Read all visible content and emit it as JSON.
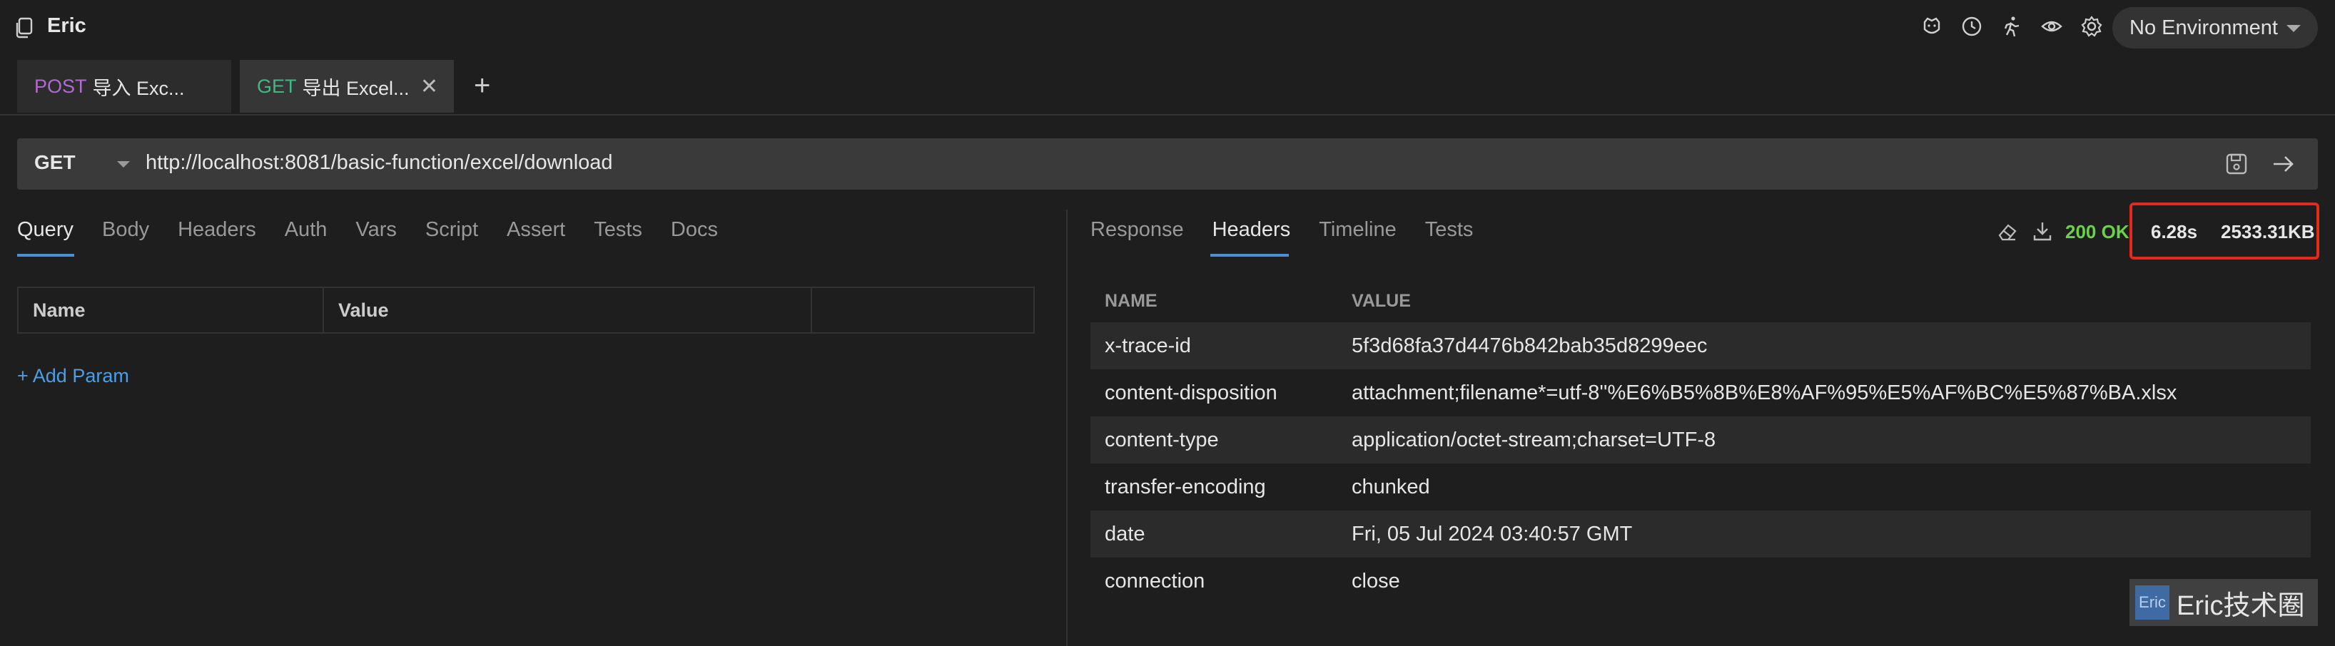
{
  "collection": {
    "name": "Eric"
  },
  "top_icons": [
    "bruno-icon",
    "history-icon",
    "runner-icon",
    "eye-icon",
    "gear-icon"
  ],
  "environment": {
    "selected": "No Environment"
  },
  "tabs": [
    {
      "method": "POST",
      "name": "导入 Exc..."
    },
    {
      "method": "GET",
      "name": "导出 Excel..."
    }
  ],
  "request": {
    "method": "GET",
    "url": "http://localhost:8081/basic-function/excel/download"
  },
  "left_tabs": [
    "Query",
    "Body",
    "Headers",
    "Auth",
    "Vars",
    "Script",
    "Assert",
    "Tests",
    "Docs"
  ],
  "params_table": {
    "columns": [
      "Name",
      "Value"
    ]
  },
  "add_param_label": "+ Add Param",
  "right_tabs": [
    "Response",
    "Headers",
    "Timeline",
    "Tests"
  ],
  "response": {
    "status": "200 OK",
    "duration": "6.28s",
    "size": "2533.31KB",
    "header_columns": [
      "NAME",
      "VALUE"
    ],
    "headers": [
      {
        "name": "x-trace-id",
        "value": "5f3d68fa37d4476b842bab35d8299eec"
      },
      {
        "name": "content-disposition",
        "value": "attachment;filename*=utf-8''%E6%B5%8B%E8%AF%95%E5%AF%BC%E5%87%BA.xlsx"
      },
      {
        "name": "content-type",
        "value": "application/octet-stream;charset=UTF-8"
      },
      {
        "name": "transfer-encoding",
        "value": "chunked"
      },
      {
        "name": "date",
        "value": "Fri, 05 Jul 2024 03:40:57 GMT"
      },
      {
        "name": "connection",
        "value": "close"
      }
    ]
  },
  "watermark": {
    "logo_text": "Eric",
    "text": "Eric技术圈"
  },
  "colors": {
    "accent": "#4a90d9",
    "post": "#b06ad2",
    "get": "#43b882",
    "status_ok": "#6bd14a",
    "highlight": "#e32a1c"
  }
}
